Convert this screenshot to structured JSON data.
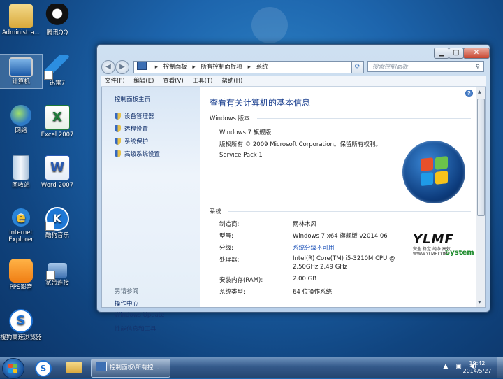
{
  "desktop": {
    "icons": [
      {
        "name": "desktop-icon-administrator",
        "label": "Administra..."
      },
      {
        "name": "desktop-icon-qq",
        "label": "腾讯QQ"
      },
      {
        "name": "desktop-icon-computer",
        "label": "计算机"
      },
      {
        "name": "desktop-icon-xunlei",
        "label": "迅雷7"
      },
      {
        "name": "desktop-icon-network",
        "label": "网络"
      },
      {
        "name": "desktop-icon-excel",
        "label": "Excel 2007"
      },
      {
        "name": "desktop-icon-recycle-bin",
        "label": "回收站"
      },
      {
        "name": "desktop-icon-word",
        "label": "Word 2007"
      },
      {
        "name": "desktop-icon-ie",
        "label": "Internet Explorer"
      },
      {
        "name": "desktop-icon-kugou",
        "label": "酷狗音乐"
      },
      {
        "name": "desktop-icon-pps",
        "label": "PPS影音"
      },
      {
        "name": "desktop-icon-broadband",
        "label": "宽带连接"
      },
      {
        "name": "desktop-icon-sogou",
        "label": "搜狗高速浏览器"
      }
    ]
  },
  "window": {
    "address": {
      "crumbs": [
        "控制面板",
        "所有控制面板项",
        "系统"
      ]
    },
    "search_placeholder": "搜索控制面板",
    "menu": [
      "文件(F)",
      "编辑(E)",
      "查看(V)",
      "工具(T)",
      "帮助(H)"
    ],
    "left_pane": {
      "home": "控制面板主页",
      "links": [
        "设备管理器",
        "远程设置",
        "系统保护",
        "高级系统设置"
      ],
      "see_also_title": "另请参阅",
      "see_also": [
        "操作中心",
        "Windows Update",
        "性能信息和工具"
      ]
    },
    "main": {
      "title": "查看有关计算机的基本信息",
      "edition_header": "Windows 版本",
      "edition": "Windows 7 旗舰版",
      "copyright": "版权所有 © 2009 Microsoft Corporation。保留所有权利。",
      "service_pack": "Service Pack 1",
      "system_header": "系统",
      "system_rows": [
        {
          "label": "制造商:",
          "value": "雨林木风"
        },
        {
          "label": "型号:",
          "value": "Windows 7 x64 旗舰版 v2014.06"
        },
        {
          "label": "分级:",
          "value": "系统分级不可用"
        },
        {
          "label": "处理器:",
          "value": "Intel(R) Core(TM) i5-3210M CPU @",
          "value2": "2.50GHz   2.49 GHz"
        },
        {
          "label": "安装内存(RAM):",
          "value": "2.00 GB"
        },
        {
          "label": "系统类型:",
          "value": "64 位操作系统"
        }
      ],
      "oem_logo": {
        "brand": "YLMF",
        "tagline": "安全 稳定 纯净 高效",
        "sub": "WWW.YLMF.COM",
        "suffix": "System"
      }
    }
  },
  "taskbar": {
    "task_label": "控制面板\\所有控...",
    "clock_time": "19:42",
    "clock_date": "2014/5/27"
  },
  "colors": {
    "accent": "#1a3f8f",
    "link": "#1a50b8",
    "taskbar": "#34598a"
  }
}
